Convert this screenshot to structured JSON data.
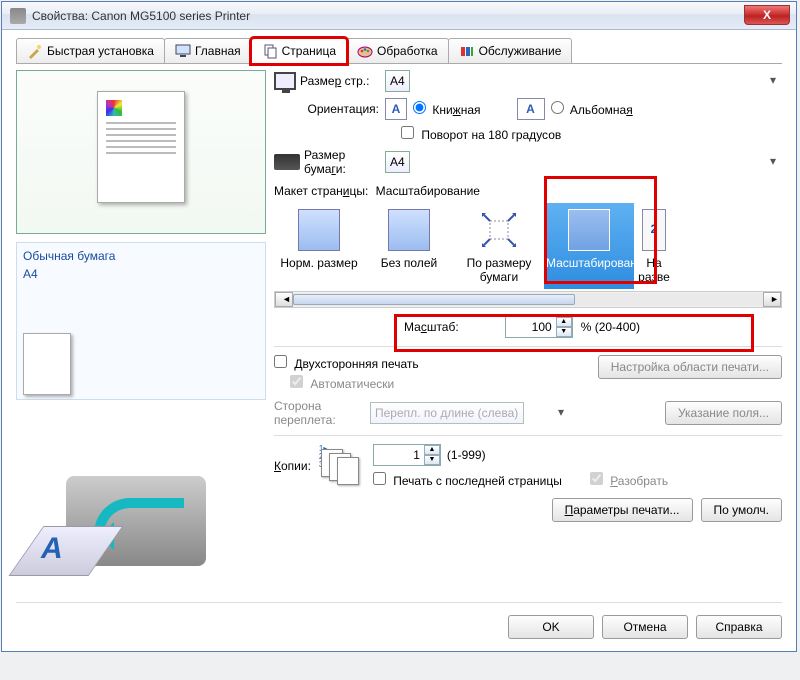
{
  "window": {
    "title": "Свойства: Canon MG5100 series Printer",
    "close_glyph": "X"
  },
  "tabs": {
    "quick": "Быстрая установка",
    "main": "Главная",
    "page": "Страница",
    "processing": "Обработка",
    "maintenance": "Обслуживание"
  },
  "preview": {
    "paper_type": "Обычная бумага",
    "paper_size": "A4"
  },
  "page_size_label": "Размер стр.:",
  "page_size_value": "A4",
  "orientation": {
    "label": "Ориентация:",
    "portrait": "Книжная",
    "landscape": "Альбомная",
    "rotate180": "Поворот на 180 градусов"
  },
  "paper_size_label": "Размер бумаги:",
  "paper_size_value": "A4",
  "layout": {
    "label": "Макет страницы:",
    "value": "Масштабирование",
    "items": {
      "normal": "Норм. размер",
      "borderless": "Без полей",
      "fit": "По размеру бумаги",
      "scaled": "Масштабирование",
      "nup": "На разве",
      "nup_badge": "2"
    }
  },
  "scale": {
    "label": "Масштаб:",
    "value": "100",
    "range": "% (20-400)"
  },
  "duplex": {
    "label": "Двухсторонняя печать",
    "auto": "Автоматически",
    "area_btn": "Настройка области печати...",
    "side_label": "Сторона переплета:",
    "side_value": "Перепл. по длине (слева)",
    "margin_btn": "Указание поля..."
  },
  "copies": {
    "label": "Копии:",
    "value": "1",
    "range": "(1-999)",
    "from_last": "Печать с последней страницы",
    "collate": "Разобрать"
  },
  "bottom": {
    "print_params": "Параметры печати...",
    "defaults": "По умолч."
  },
  "dialog": {
    "ok": "OK",
    "cancel": "Отмена",
    "help": "Справка"
  }
}
